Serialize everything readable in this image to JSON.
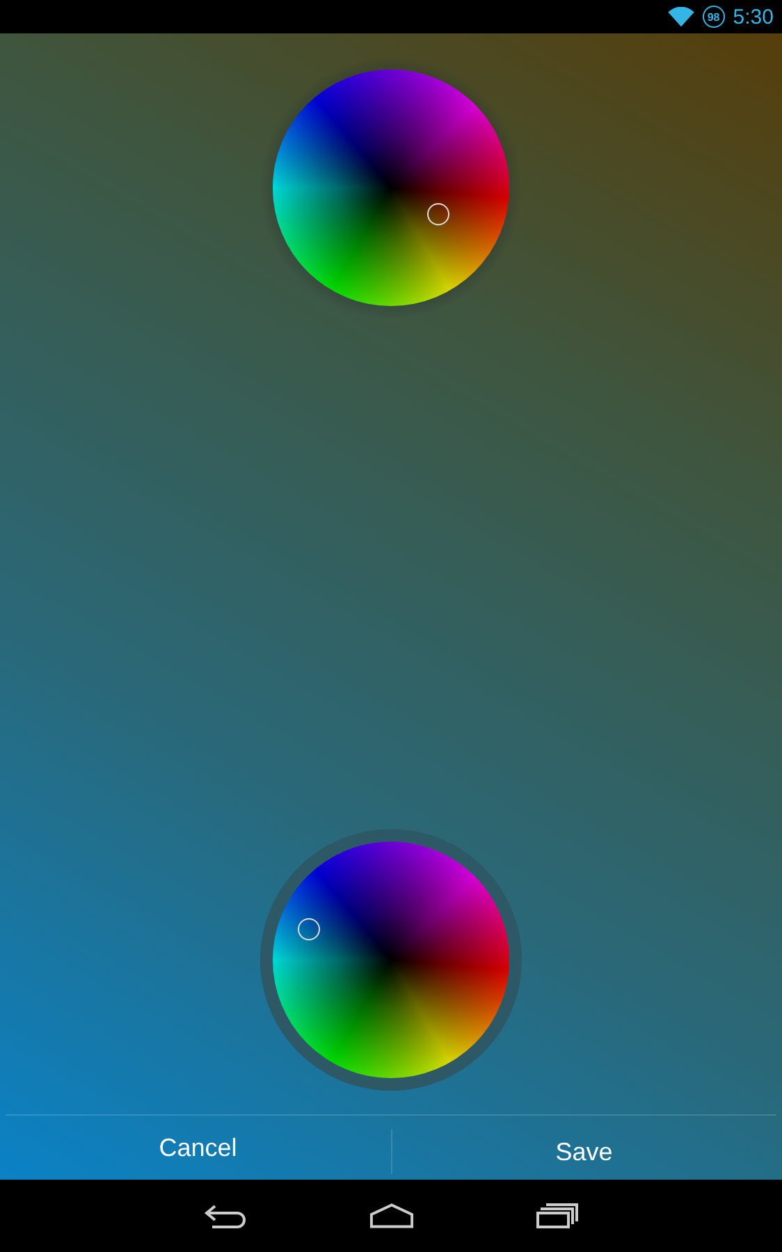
{
  "status_bar": {
    "battery": "98",
    "time": "5:30"
  },
  "wheels": [
    {
      "selected": false
    },
    {
      "selected": true
    }
  ],
  "buttons": [
    "Cancel",
    "Save"
  ]
}
